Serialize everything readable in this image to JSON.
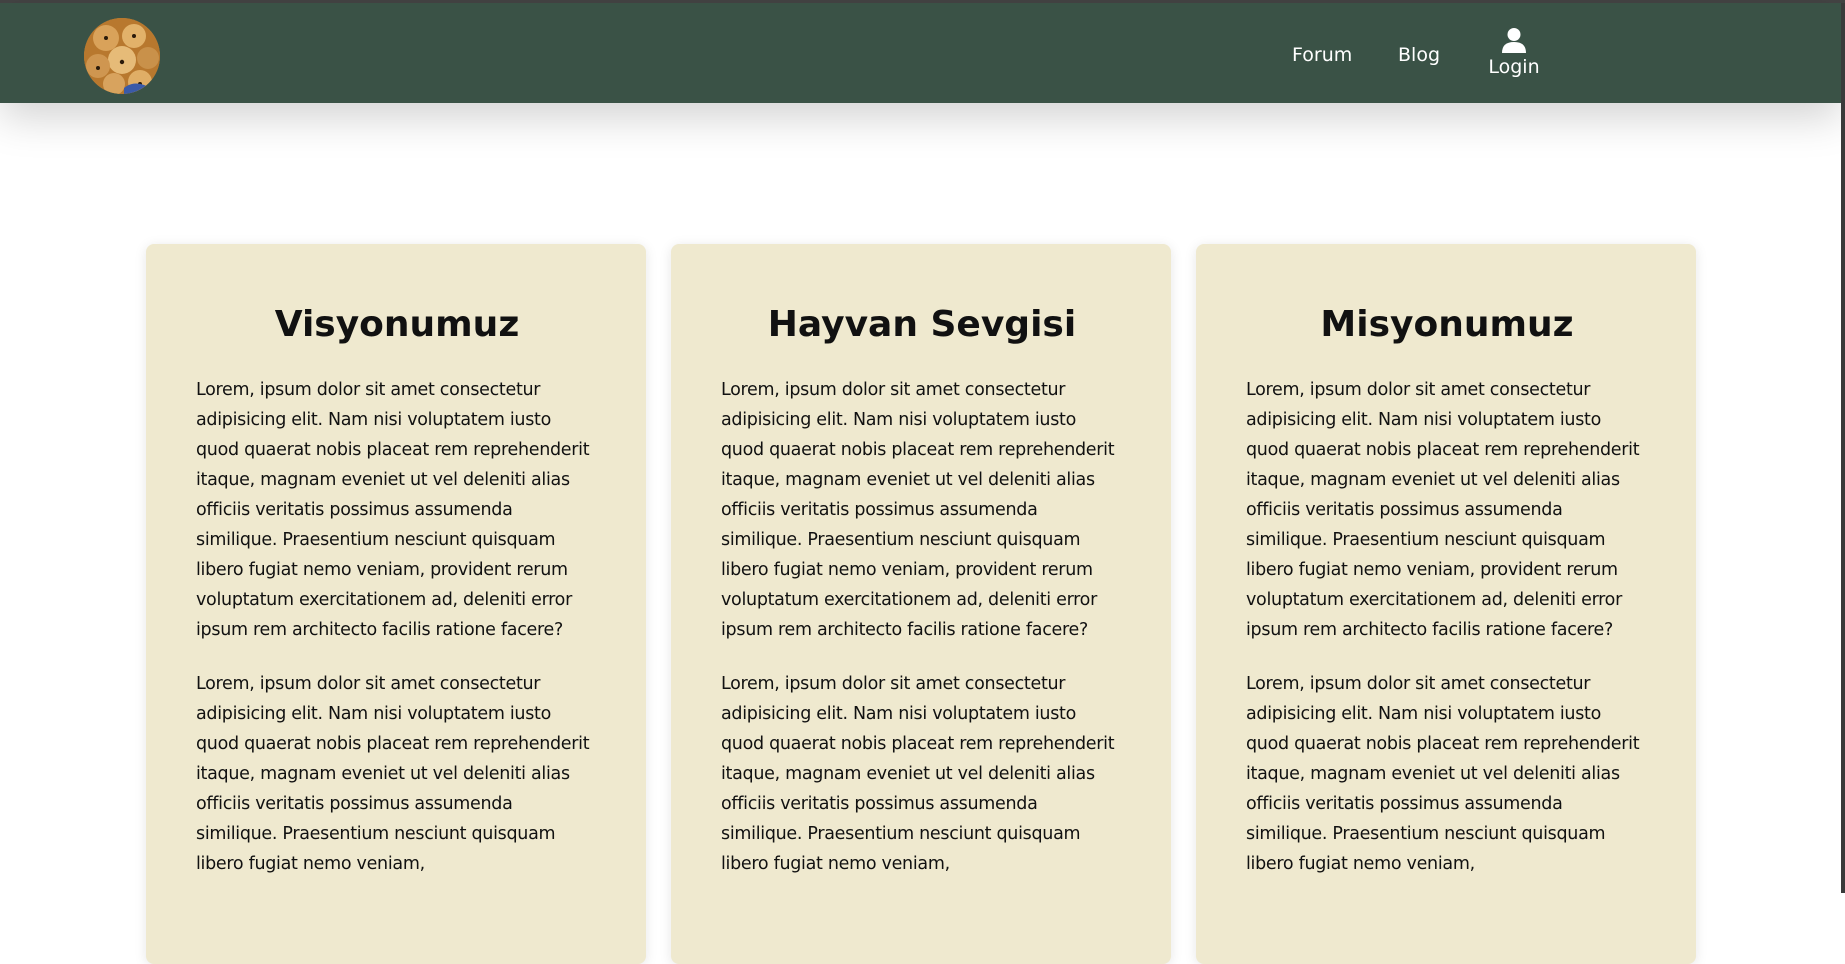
{
  "nav": {
    "logo_alt": "puppies",
    "links": [
      {
        "label": "Forum"
      },
      {
        "label": "Blog"
      }
    ],
    "login": {
      "label": "Login",
      "icon": "user-icon"
    }
  },
  "cards": [
    {
      "title": "Visyonumuz",
      "paragraphs": [
        "Lorem, ipsum dolor sit amet consectetur adipisicing elit. Nam nisi voluptatem iusto quod quaerat nobis placeat rem reprehenderit itaque, magnam eveniet ut vel deleniti alias officiis veritatis possimus assumenda similique. Praesentium nesciunt quisquam libero fugiat nemo veniam, provident rerum voluptatum exercitationem ad, deleniti error ipsum rem architecto facilis ratione facere?",
        "Lorem, ipsum dolor sit amet consectetur adipisicing elit. Nam nisi voluptatem iusto quod quaerat nobis placeat rem reprehenderit itaque, magnam eveniet ut vel deleniti alias officiis veritatis possimus assumenda similique. Praesentium nesciunt quisquam libero fugiat nemo veniam,"
      ]
    },
    {
      "title": "Hayvan Sevgisi",
      "paragraphs": [
        "Lorem, ipsum dolor sit amet consectetur adipisicing elit. Nam nisi voluptatem iusto quod quaerat nobis placeat rem reprehenderit itaque, magnam eveniet ut vel deleniti alias officiis veritatis possimus assumenda similique. Praesentium nesciunt quisquam libero fugiat nemo veniam, provident rerum voluptatum exercitationem ad, deleniti error ipsum rem architecto facilis ratione facere?",
        "Lorem, ipsum dolor sit amet consectetur adipisicing elit. Nam nisi voluptatem iusto quod quaerat nobis placeat rem reprehenderit itaque, magnam eveniet ut vel deleniti alias officiis veritatis possimus assumenda similique. Praesentium nesciunt quisquam libero fugiat nemo veniam,"
      ]
    },
    {
      "title": "Misyonumuz",
      "paragraphs": [
        "Lorem, ipsum dolor sit amet consectetur adipisicing elit. Nam nisi voluptatem iusto quod quaerat nobis placeat rem reprehenderit itaque, magnam eveniet ut vel deleniti alias officiis veritatis possimus assumenda similique. Praesentium nesciunt quisquam libero fugiat nemo veniam, provident rerum voluptatum exercitationem ad, deleniti error ipsum rem architecto facilis ratione facere?",
        "Lorem, ipsum dolor sit amet consectetur adipisicing elit. Nam nisi voluptatem iusto quod quaerat nobis placeat rem reprehenderit itaque, magnam eveniet ut vel deleniti alias officiis veritatis possimus assumenda similique. Praesentium nesciunt quisquam libero fugiat nemo veniam,"
      ]
    }
  ],
  "colors": {
    "navbar": "#3a5246",
    "card": "#efe9cf",
    "text": "#111111"
  }
}
